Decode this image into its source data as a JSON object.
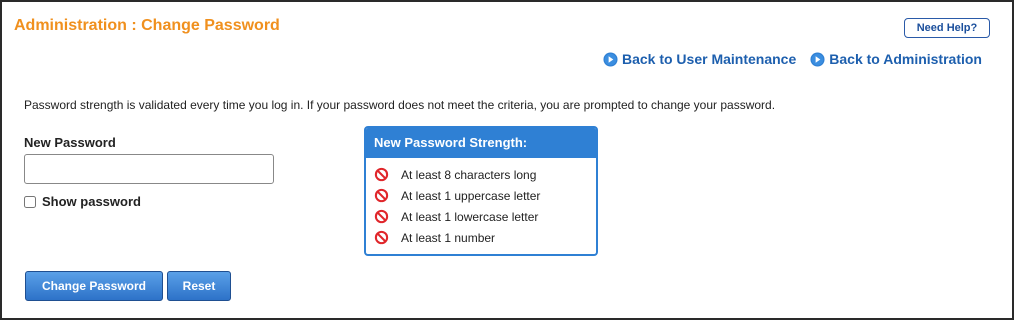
{
  "page": {
    "title": "Administration : Change Password",
    "help_button": "Need Help?"
  },
  "nav_links": [
    {
      "label": "Back to User Maintenance",
      "icon": "arrow-right-circle-icon"
    },
    {
      "label": "Back to Administration",
      "icon": "arrow-right-circle-icon"
    }
  ],
  "description": "Password strength is validated every time you log in. If your password does not meet the criteria, you are prompted to change your password.",
  "form": {
    "new_password_label": "New Password",
    "new_password_value": "",
    "show_password_label": "Show password",
    "show_password_checked": false
  },
  "strength": {
    "heading": "New Password Strength:",
    "criteria": [
      {
        "label": "At least 8 characters long",
        "met": false
      },
      {
        "label": "At least 1 uppercase letter",
        "met": false
      },
      {
        "label": "At least 1 lowercase letter",
        "met": false
      },
      {
        "label": "At least 1 number",
        "met": false
      }
    ]
  },
  "buttons": {
    "change_password": "Change Password",
    "reset": "Reset"
  },
  "colors": {
    "title": "#f0901e",
    "link": "#1d5fae",
    "panel_accent": "#2f80d4",
    "unmet_icon": "#e0262b"
  }
}
